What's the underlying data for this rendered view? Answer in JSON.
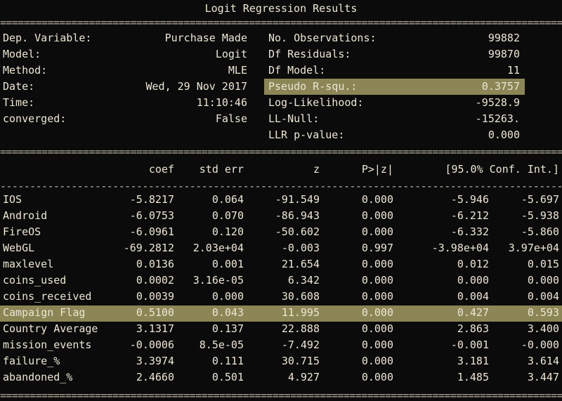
{
  "title": "Logit Regression Results",
  "info_left": [
    {
      "label": "Dep. Variable:",
      "value": "Purchase Made"
    },
    {
      "label": "Model:",
      "value": "Logit"
    },
    {
      "label": "Method:",
      "value": "MLE"
    },
    {
      "label": "Date:",
      "value": "Wed, 29 Nov 2017"
    },
    {
      "label": "Time:",
      "value": "11:10:46"
    },
    {
      "label": "converged:",
      "value": "False"
    }
  ],
  "info_right": [
    {
      "label": "No. Observations:",
      "value": "99882"
    },
    {
      "label": "Df Residuals:",
      "value": "99870"
    },
    {
      "label": "Df Model:",
      "value": "11"
    },
    {
      "label": "Pseudo R-squ.:",
      "value": "0.3757",
      "highlight": true
    },
    {
      "label": "Log-Likelihood:",
      "value": "-9528.9"
    },
    {
      "label": "LL-Null:",
      "value": "-15263."
    },
    {
      "label": "LLR p-value:",
      "value": "0.000"
    }
  ],
  "table_headers": [
    "coef",
    "std err",
    "z",
    "P>|z|",
    "[95.0% Conf. Int.]"
  ],
  "rows": [
    {
      "name": "IOS",
      "coef": "-5.8217",
      "std": "0.064",
      "z": "-91.549",
      "p": "0.000",
      "lo": "-5.946",
      "hi": "-5.697"
    },
    {
      "name": "Android",
      "coef": "-6.0753",
      "std": "0.070",
      "z": "-86.943",
      "p": "0.000",
      "lo": "-6.212",
      "hi": "-5.938"
    },
    {
      "name": "FireOS",
      "coef": "-6.0961",
      "std": "0.120",
      "z": "-50.602",
      "p": "0.000",
      "lo": "-6.332",
      "hi": "-5.860"
    },
    {
      "name": "WebGL",
      "coef": "-69.2812",
      "std": "2.03e+04",
      "z": "-0.003",
      "p": "0.997",
      "lo": "-3.98e+04",
      "hi": "3.97e+04"
    },
    {
      "name": "maxlevel",
      "coef": "0.0136",
      "std": "0.001",
      "z": "21.654",
      "p": "0.000",
      "lo": "0.012",
      "hi": "0.015"
    },
    {
      "name": "coins_used",
      "coef": "0.0002",
      "std": "3.16e-05",
      "z": "6.342",
      "p": "0.000",
      "lo": "0.000",
      "hi": "0.000"
    },
    {
      "name": "coins_received",
      "coef": "0.0039",
      "std": "0.000",
      "z": "30.608",
      "p": "0.000",
      "lo": "0.004",
      "hi": "0.004"
    },
    {
      "name": "Campaign Flag",
      "coef": "0.5100",
      "std": "0.043",
      "z": "11.995",
      "p": "0.000",
      "lo": "0.427",
      "hi": "0.593",
      "highlight": true
    },
    {
      "name": "Country Average",
      "coef": "3.1317",
      "std": "0.137",
      "z": "22.888",
      "p": "0.000",
      "lo": "2.863",
      "hi": "3.400"
    },
    {
      "name": "mission_events",
      "coef": "-0.0006",
      "std": "8.5e-05",
      "z": "-7.492",
      "p": "0.000",
      "lo": "-0.001",
      "hi": "-0.000"
    },
    {
      "name": "failure_%",
      "coef": "3.3974",
      "std": "0.111",
      "z": "30.715",
      "p": "0.000",
      "lo": "3.181",
      "hi": "3.614"
    },
    {
      "name": "abandoned_%",
      "coef": "2.4660",
      "std": "0.501",
      "z": "4.927",
      "p": "0.000",
      "lo": "1.485",
      "hi": "3.447"
    }
  ],
  "colors": {
    "background": "#0b0b0b",
    "text": "#ece6d4",
    "highlight": "#8c8656"
  }
}
